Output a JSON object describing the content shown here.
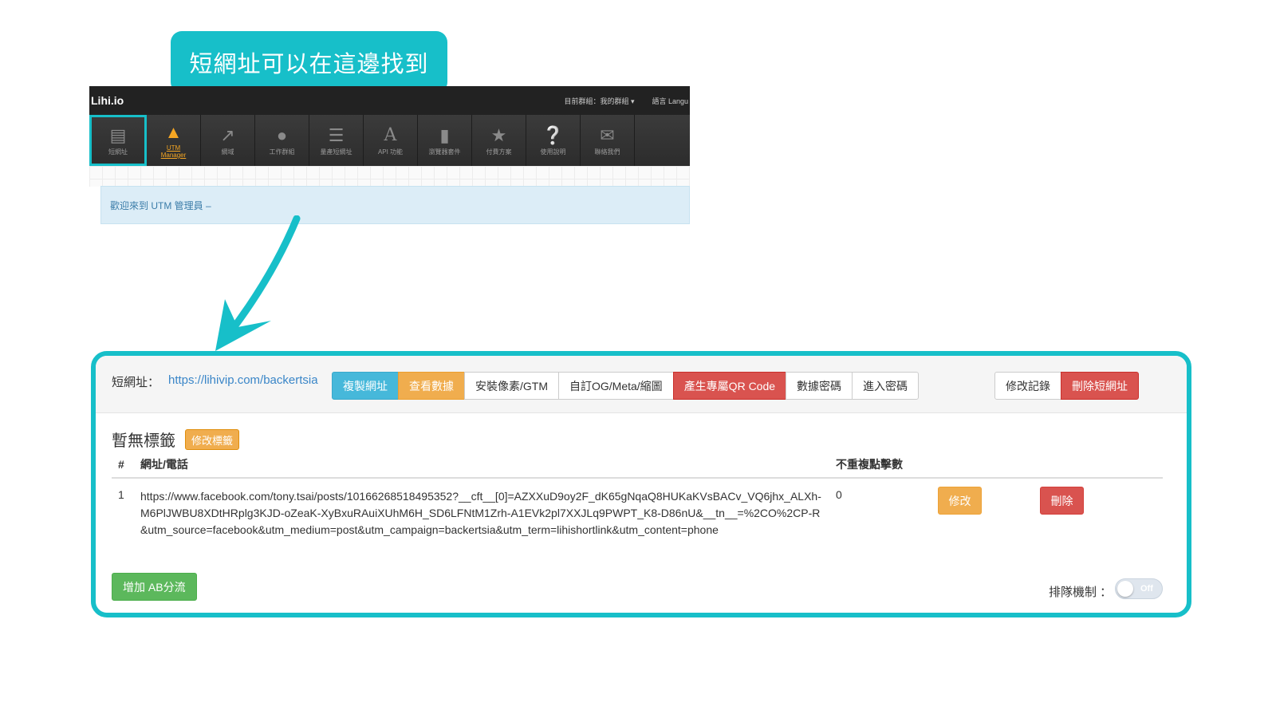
{
  "callout": {
    "text": "短網址可以在這邊找到"
  },
  "topbar": {
    "brand": "Lihi.io",
    "group": "目前群組：我的群組 ▾",
    "language": "語言 Langu"
  },
  "nav": {
    "items": [
      {
        "label": "短網址",
        "icon": "list-icon"
      },
      {
        "label_top": "UTM",
        "label_bottom": "Manager",
        "icon": "utm-road-icon"
      },
      {
        "label": "網域",
        "icon": "external-link-icon"
      },
      {
        "label": "工作群組",
        "icon": "users-icon"
      },
      {
        "label": "量產短網址",
        "icon": "bulk-list-icon"
      },
      {
        "label": "API 功能",
        "icon": "api-letter-icon"
      },
      {
        "label": "瀏覽器套件",
        "icon": "bookmark-icon"
      },
      {
        "label": "付費方案",
        "icon": "star-icon"
      },
      {
        "label": "使用說明",
        "icon": "help-icon"
      },
      {
        "label": "聯絡我們",
        "icon": "mail-icon"
      }
    ]
  },
  "welcome": {
    "text": "歡迎來到 UTM 管理員 –"
  },
  "panel": {
    "short_label": "短網址：",
    "short_url": "https://lihivip.com/backertsia",
    "toolbar": {
      "copy": "複製網址",
      "stats": "查看數據",
      "pixel": "安裝像素/GTM",
      "og": "自訂OG/Meta/縮圖",
      "qr": "產生專屬QR Code",
      "data_pw": "數據密碼",
      "enter_pw": "進入密碼",
      "history": "修改記錄",
      "delete": "刪除短網址"
    },
    "tag_title": "暫無標籤",
    "tag_edit": "修改標籤",
    "table": {
      "headers": [
        "#",
        "網址/電話",
        "不重複點擊數"
      ],
      "rows": [
        {
          "index": "1",
          "url": "https://www.facebook.com/tony.tsai/posts/10166268518495352?__cft__[0]=AZXXuD9oy2F_dK65gNqaQ8HUKaKVsBACv_VQ6jhx_ALXh-M6PlJWBU8XDtHRplg3KJD-oZeaK-XyBxuRAuiXUhM6H_SD6LFNtM1Zrh-A1EVk2pl7XXJLq9PWPT_K8-D86nU&__tn__=%2CO%2CP-R&utm_source=facebook&utm_medium=post&utm_campaign=backertsia&utm_term=lihishortlink&utm_content=phone",
          "clicks": "0",
          "edit": "修改",
          "delete": "刪除"
        }
      ]
    },
    "ab_button": "增加 AB分流",
    "queue_label": "排隊機制 ：",
    "queue_toggle": "Off"
  },
  "colors": {
    "accent": "#17bfc9",
    "info": "#46b8da",
    "warning": "#f0ad4e",
    "danger": "#d9534f",
    "success": "#5cb85c"
  }
}
